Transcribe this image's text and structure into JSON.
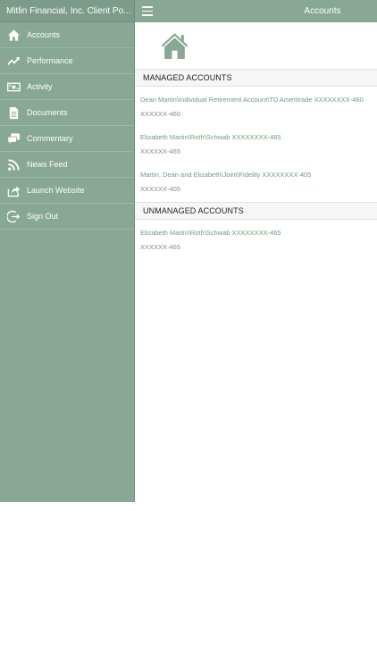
{
  "sidebar": {
    "title": "Mitlin Financial, Inc. Client Po...",
    "items": [
      {
        "label": "Accounts",
        "icon": "home-icon"
      },
      {
        "label": "Performance",
        "icon": "trend-up-icon"
      },
      {
        "label": "Activity",
        "icon": "money-icon"
      },
      {
        "label": "Documents",
        "icon": "document-icon"
      },
      {
        "label": "Commentary",
        "icon": "chat-icon"
      },
      {
        "label": "News Feed",
        "icon": "rss-icon"
      },
      {
        "label": "Launch Website",
        "icon": "share-icon"
      },
      {
        "label": "Sign Out",
        "icon": "sign-out-icon"
      }
    ]
  },
  "topbar": {
    "title": "Accounts"
  },
  "sections": {
    "managed": {
      "header": "MANAGED ACCOUNTS",
      "accounts": [
        {
          "name": "Dean Martin\\Individual Retirement Account\\TD Ameritrade XXXXXXXX-460",
          "number": "XXXXXX-460"
        },
        {
          "name": "Elizabeth Martin\\Roth\\Schwab XXXXXXXX-465",
          "number": "XXXXXX-465"
        },
        {
          "name": "Martin, Dean and Elizabeth\\Joint\\Fidelity XXXXXXXX-405",
          "number": "XXXXXX-405"
        }
      ]
    },
    "unmanaged": {
      "header": "UNMANAGED ACCOUNTS",
      "accounts": [
        {
          "name": "Elizabeth Martin\\Roth\\Schwab XXXXXXXX-465",
          "number": "XXXXXX-465"
        }
      ]
    }
  },
  "colors": {
    "sidebar_bg": "#88a795",
    "accent_text": "#6f9a82"
  }
}
